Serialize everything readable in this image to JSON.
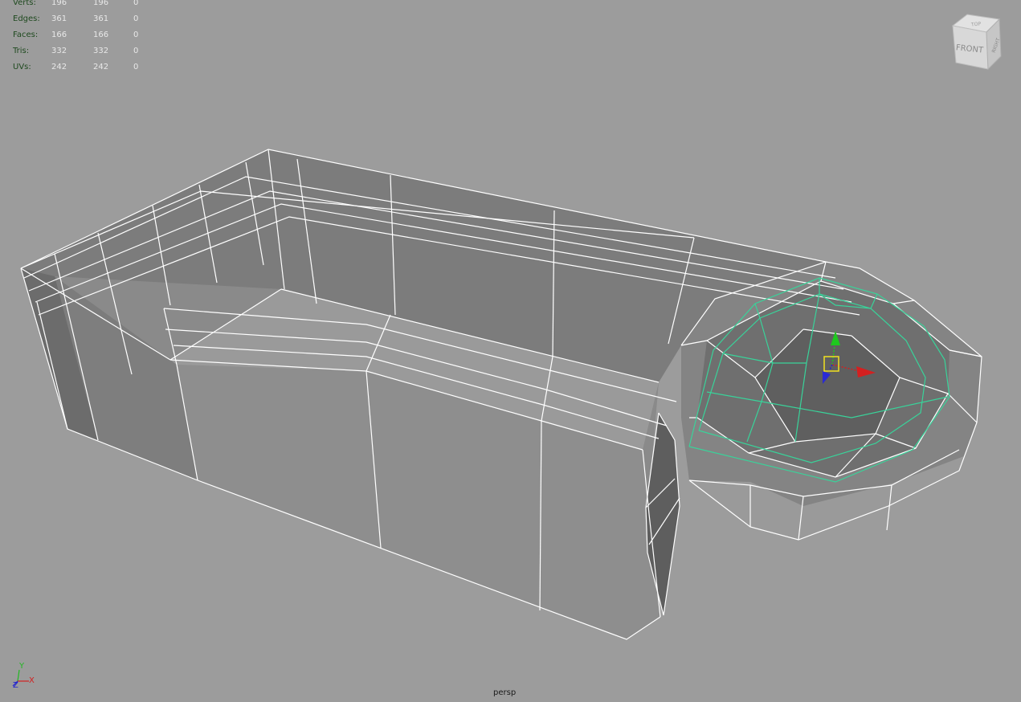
{
  "hud": {
    "rows": [
      {
        "label": "Verts:",
        "a": "196",
        "b": "196",
        "c": "0"
      },
      {
        "label": "Edges:",
        "a": "361",
        "b": "361",
        "c": "0"
      },
      {
        "label": "Faces:",
        "a": "166",
        "b": "166",
        "c": "0"
      },
      {
        "label": "Tris:",
        "a": "332",
        "b": "332",
        "c": "0"
      },
      {
        "label": "UVs:",
        "a": "242",
        "b": "242",
        "c": "0"
      }
    ]
  },
  "viewport": {
    "camera_label": "persp",
    "background_color": "#9c9c9c",
    "wire_color": "#ffffff",
    "selection_color": "#39d39a"
  },
  "view_cube": {
    "front_label": "FRONT",
    "top_label": "TOP",
    "right_label": "RIGHT"
  },
  "axis_indicator": {
    "x_label": "X",
    "y_label": "Y",
    "z_label": "Z"
  },
  "manipulator": {
    "icons": [
      "move-y-arrow-icon",
      "move-x-arrow-icon",
      "move-z-arrow-icon",
      "center-handle-icon"
    ]
  }
}
